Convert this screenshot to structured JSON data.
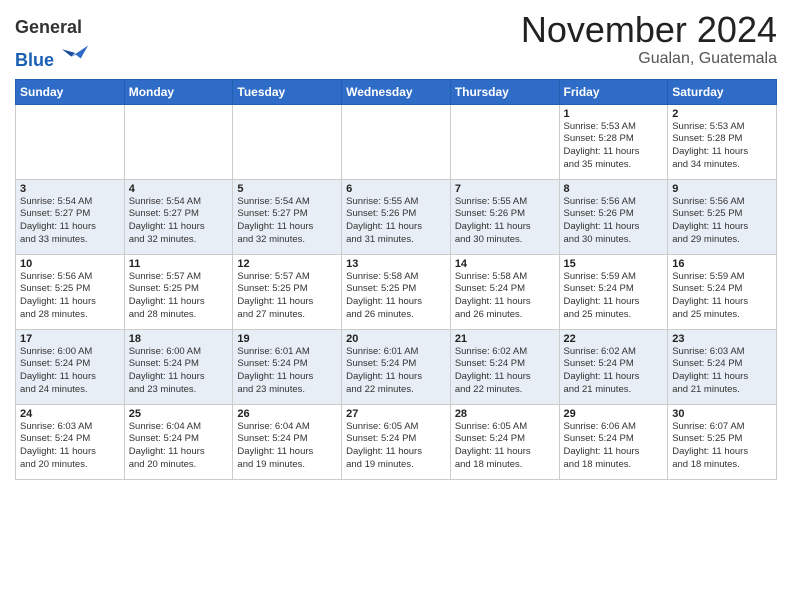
{
  "header": {
    "logo_general": "General",
    "logo_blue": "Blue",
    "month_title": "November 2024",
    "location": "Gualan, Guatemala"
  },
  "weekdays": [
    "Sunday",
    "Monday",
    "Tuesday",
    "Wednesday",
    "Thursday",
    "Friday",
    "Saturday"
  ],
  "weeks": [
    [
      {
        "day": "",
        "info": ""
      },
      {
        "day": "",
        "info": ""
      },
      {
        "day": "",
        "info": ""
      },
      {
        "day": "",
        "info": ""
      },
      {
        "day": "",
        "info": ""
      },
      {
        "day": "1",
        "info": "Sunrise: 5:53 AM\nSunset: 5:28 PM\nDaylight: 11 hours\nand 35 minutes."
      },
      {
        "day": "2",
        "info": "Sunrise: 5:53 AM\nSunset: 5:28 PM\nDaylight: 11 hours\nand 34 minutes."
      }
    ],
    [
      {
        "day": "3",
        "info": "Sunrise: 5:54 AM\nSunset: 5:27 PM\nDaylight: 11 hours\nand 33 minutes."
      },
      {
        "day": "4",
        "info": "Sunrise: 5:54 AM\nSunset: 5:27 PM\nDaylight: 11 hours\nand 32 minutes."
      },
      {
        "day": "5",
        "info": "Sunrise: 5:54 AM\nSunset: 5:27 PM\nDaylight: 11 hours\nand 32 minutes."
      },
      {
        "day": "6",
        "info": "Sunrise: 5:55 AM\nSunset: 5:26 PM\nDaylight: 11 hours\nand 31 minutes."
      },
      {
        "day": "7",
        "info": "Sunrise: 5:55 AM\nSunset: 5:26 PM\nDaylight: 11 hours\nand 30 minutes."
      },
      {
        "day": "8",
        "info": "Sunrise: 5:56 AM\nSunset: 5:26 PM\nDaylight: 11 hours\nand 30 minutes."
      },
      {
        "day": "9",
        "info": "Sunrise: 5:56 AM\nSunset: 5:25 PM\nDaylight: 11 hours\nand 29 minutes."
      }
    ],
    [
      {
        "day": "10",
        "info": "Sunrise: 5:56 AM\nSunset: 5:25 PM\nDaylight: 11 hours\nand 28 minutes."
      },
      {
        "day": "11",
        "info": "Sunrise: 5:57 AM\nSunset: 5:25 PM\nDaylight: 11 hours\nand 28 minutes."
      },
      {
        "day": "12",
        "info": "Sunrise: 5:57 AM\nSunset: 5:25 PM\nDaylight: 11 hours\nand 27 minutes."
      },
      {
        "day": "13",
        "info": "Sunrise: 5:58 AM\nSunset: 5:25 PM\nDaylight: 11 hours\nand 26 minutes."
      },
      {
        "day": "14",
        "info": "Sunrise: 5:58 AM\nSunset: 5:24 PM\nDaylight: 11 hours\nand 26 minutes."
      },
      {
        "day": "15",
        "info": "Sunrise: 5:59 AM\nSunset: 5:24 PM\nDaylight: 11 hours\nand 25 minutes."
      },
      {
        "day": "16",
        "info": "Sunrise: 5:59 AM\nSunset: 5:24 PM\nDaylight: 11 hours\nand 25 minutes."
      }
    ],
    [
      {
        "day": "17",
        "info": "Sunrise: 6:00 AM\nSunset: 5:24 PM\nDaylight: 11 hours\nand 24 minutes."
      },
      {
        "day": "18",
        "info": "Sunrise: 6:00 AM\nSunset: 5:24 PM\nDaylight: 11 hours\nand 23 minutes."
      },
      {
        "day": "19",
        "info": "Sunrise: 6:01 AM\nSunset: 5:24 PM\nDaylight: 11 hours\nand 23 minutes."
      },
      {
        "day": "20",
        "info": "Sunrise: 6:01 AM\nSunset: 5:24 PM\nDaylight: 11 hours\nand 22 minutes."
      },
      {
        "day": "21",
        "info": "Sunrise: 6:02 AM\nSunset: 5:24 PM\nDaylight: 11 hours\nand 22 minutes."
      },
      {
        "day": "22",
        "info": "Sunrise: 6:02 AM\nSunset: 5:24 PM\nDaylight: 11 hours\nand 21 minutes."
      },
      {
        "day": "23",
        "info": "Sunrise: 6:03 AM\nSunset: 5:24 PM\nDaylight: 11 hours\nand 21 minutes."
      }
    ],
    [
      {
        "day": "24",
        "info": "Sunrise: 6:03 AM\nSunset: 5:24 PM\nDaylight: 11 hours\nand 20 minutes."
      },
      {
        "day": "25",
        "info": "Sunrise: 6:04 AM\nSunset: 5:24 PM\nDaylight: 11 hours\nand 20 minutes."
      },
      {
        "day": "26",
        "info": "Sunrise: 6:04 AM\nSunset: 5:24 PM\nDaylight: 11 hours\nand 19 minutes."
      },
      {
        "day": "27",
        "info": "Sunrise: 6:05 AM\nSunset: 5:24 PM\nDaylight: 11 hours\nand 19 minutes."
      },
      {
        "day": "28",
        "info": "Sunrise: 6:05 AM\nSunset: 5:24 PM\nDaylight: 11 hours\nand 18 minutes."
      },
      {
        "day": "29",
        "info": "Sunrise: 6:06 AM\nSunset: 5:24 PM\nDaylight: 11 hours\nand 18 minutes."
      },
      {
        "day": "30",
        "info": "Sunrise: 6:07 AM\nSunset: 5:25 PM\nDaylight: 11 hours\nand 18 minutes."
      }
    ]
  ]
}
